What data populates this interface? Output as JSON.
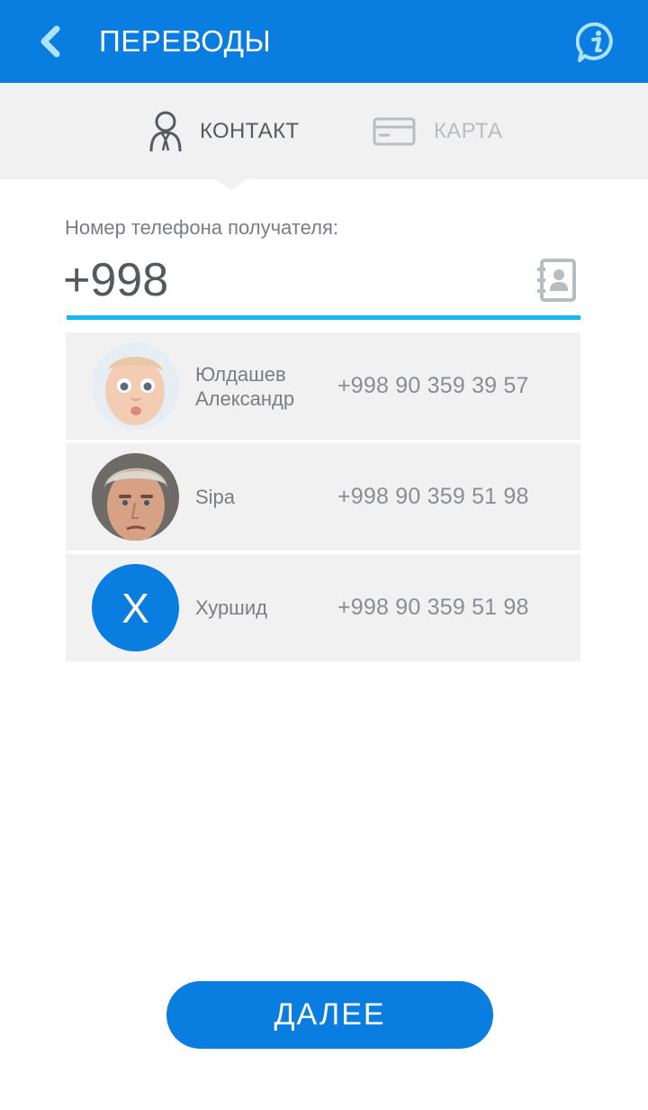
{
  "header": {
    "title": "ПЕРЕВОДЫ",
    "back_icon": "chevron-left-icon",
    "info_icon": "info-icon",
    "color": "#0a7de0"
  },
  "tabs": [
    {
      "label": "КОНТАКТ",
      "icon": "person-icon",
      "active": true
    },
    {
      "label": "КАРТА",
      "icon": "card-icon",
      "active": false
    }
  ],
  "phone_field": {
    "label": "Номер телефона получателя:",
    "value": "+998",
    "contacts_icon": "contacts-book-icon",
    "underline_color": "#1ab7f0"
  },
  "contacts": [
    {
      "name": "Юлдашев Александр",
      "phone": "+998 90 359 39 57",
      "avatar": "photo"
    },
    {
      "name": "Sipa",
      "phone": "+998 90 359 51 98",
      "avatar": "photo"
    },
    {
      "name": "Хуршид",
      "phone": "+998 90 359 51 98",
      "avatar": "letter",
      "avatar_letter": "Х"
    }
  ],
  "next_button": {
    "label": "ДАЛЕЕ"
  }
}
